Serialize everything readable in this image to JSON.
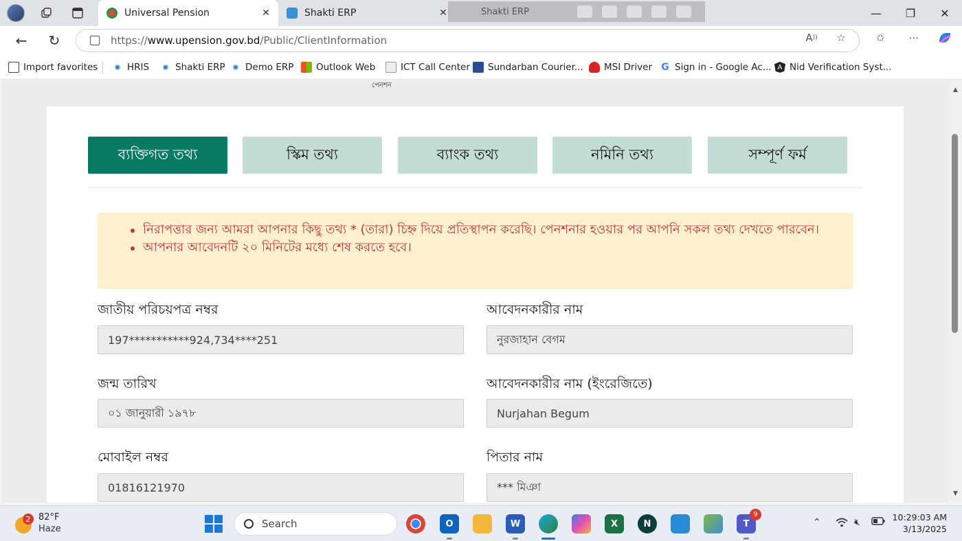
{
  "browser": {
    "tabs": [
      {
        "title": "Universal Pension",
        "active": true
      },
      {
        "title": "Shakti ERP",
        "active": false
      }
    ],
    "drag_overlay_title": "Shakti ERP",
    "url_domain": "www.upension.gov.bd",
    "url_scheme": "https://",
    "url_path": "/Public/ClientInformation",
    "favorites": [
      {
        "label": "Import favorites",
        "icon": "import-icon"
      },
      {
        "label": "HRIS",
        "icon": "shakti-logo-icon"
      },
      {
        "label": "Shakti ERP",
        "icon": "shakti-logo-icon"
      },
      {
        "label": "Demo ERP",
        "icon": "shakti-logo-icon"
      },
      {
        "label": "Outlook Web",
        "icon": "microsoft-logo-icon"
      },
      {
        "label": "ICT Call Center",
        "icon": "broken-image-icon"
      },
      {
        "label": "Sundarban Courier...",
        "icon": "courier-logo-icon"
      },
      {
        "label": "MSI Driver",
        "icon": "msi-logo-icon"
      },
      {
        "label": "Sign in - Google Ac...",
        "icon": "google-g-icon"
      },
      {
        "label": "Nid Verification Syst...",
        "icon": "angular-logo-icon"
      }
    ]
  },
  "page": {
    "header_logo_tail": "পেনশন",
    "steps": [
      {
        "label": "ব্যক্তিগত তথ্য",
        "active": true
      },
      {
        "label": "স্কিম তথ্য",
        "active": false
      },
      {
        "label": "ব্যাংক তথ্য",
        "active": false
      },
      {
        "label": "নমিনি তথ্য",
        "active": false
      },
      {
        "label": "সম্পূর্ণ ফর্ম",
        "active": false
      }
    ],
    "notices": [
      "নিরাপত্তার জন্য আমরা আপনার কিছু তথ্য * (তারা) চিহ্ন দিয়ে প্রতিস্থাপন করেছি। পেনশনার হওয়ার পর আপনি সকল তথ্য দেখতে পারবেন।",
      "আপনার আবেদনটি ২০ মিনিটের মধ্যে শেষ করতে হবে।"
    ],
    "fields": {
      "nid": {
        "label": "জাতীয় পরিচয়পত্র নম্বর",
        "value": "197***********924,734****251"
      },
      "applicant_name": {
        "label": "আবেদনকারীর নাম",
        "value": "নুরজাহান বেগম"
      },
      "dob": {
        "label": "জন্ম তারিখ",
        "value": "০১ জানুয়ারী ১৯৭৮"
      },
      "applicant_name_en": {
        "label": "আবেদনকারীর নাম (ইংরেজিতে)",
        "value": "Nurjahan Begum"
      },
      "mobile": {
        "label": "মোবাইল নম্বর",
        "value": "01816121970"
      },
      "father_name": {
        "label": "পিতার নাম",
        "value": "*** মিঞা"
      }
    }
  },
  "taskbar": {
    "weather_temp": "82°F",
    "weather_condition": "Haze",
    "weather_badge": "2",
    "search_label": "Search",
    "teams_badge": "9",
    "time": "10:29:03 AM",
    "date": "3/13/2025"
  },
  "colors": {
    "step_active": "#087b62",
    "step_idle": "#c3ddd6",
    "alert_bg": "#fdf0cf",
    "alert_text": "#c5313a"
  }
}
